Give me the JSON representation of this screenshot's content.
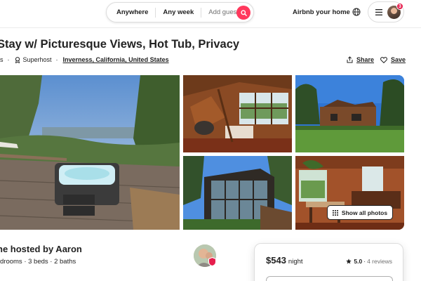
{
  "header": {
    "search": {
      "location": "Anywhere",
      "dates": "Any week",
      "guests": "Add guests"
    },
    "host_link": "Airbnb your home",
    "notification_count": "3"
  },
  "listing": {
    "title": "Stay w/ Picturesque Views, Hot Tub, Privacy",
    "reviews_fragment": "s",
    "superhost": "Superhost",
    "location": "Inverness, California, United States",
    "share_label": "Share",
    "save_label": "Save"
  },
  "photos": {
    "show_all_label": "Show all photos"
  },
  "host": {
    "heading": "ne hosted by Aaron",
    "details": "drooms · 3 beds · 2 baths"
  },
  "booking": {
    "price": "$543",
    "per": "night",
    "rating": "5.0",
    "sep": "·",
    "reviews": "4 reviews"
  },
  "colors": {
    "brand": "#ff385c",
    "text": "#222222",
    "muted": "#717171",
    "border": "#dddddd"
  },
  "icons": [
    "search-icon",
    "globe-icon",
    "hamburger-icon",
    "medal-icon",
    "share-icon",
    "heart-icon",
    "grid-icon",
    "star-icon"
  ]
}
